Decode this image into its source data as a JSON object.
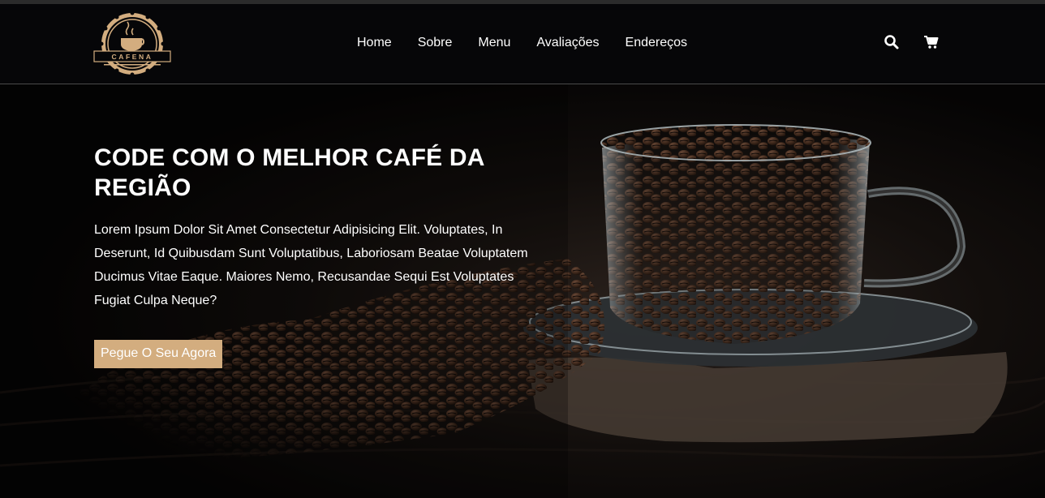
{
  "brand": {
    "name": "CAFENA",
    "accent_color": "#d3ad7f"
  },
  "nav": {
    "items": [
      {
        "label": "Home"
      },
      {
        "label": "Sobre"
      },
      {
        "label": "Menu"
      },
      {
        "label": "Avaliações"
      },
      {
        "label": "Endereços"
      }
    ],
    "icons": [
      "search-icon",
      "cart-icon"
    ]
  },
  "hero": {
    "title": "CODE COM O MELHOR CAFÉ DA REGIÃO",
    "text": "Lorem Ipsum Dolor Sit Amet Consectetur Adipisicing Elit. Voluptates, In Deserunt, Id Quibusdam Sunt Voluptatibus, Laboriosam Beatae Voluptatem Ducimus Vitae Eaque. Maiores Nemo, Recusandae Sequi Est Voluptates Fugiat Culpa Neque?",
    "button_label": "Pegue O Seu Agora"
  }
}
